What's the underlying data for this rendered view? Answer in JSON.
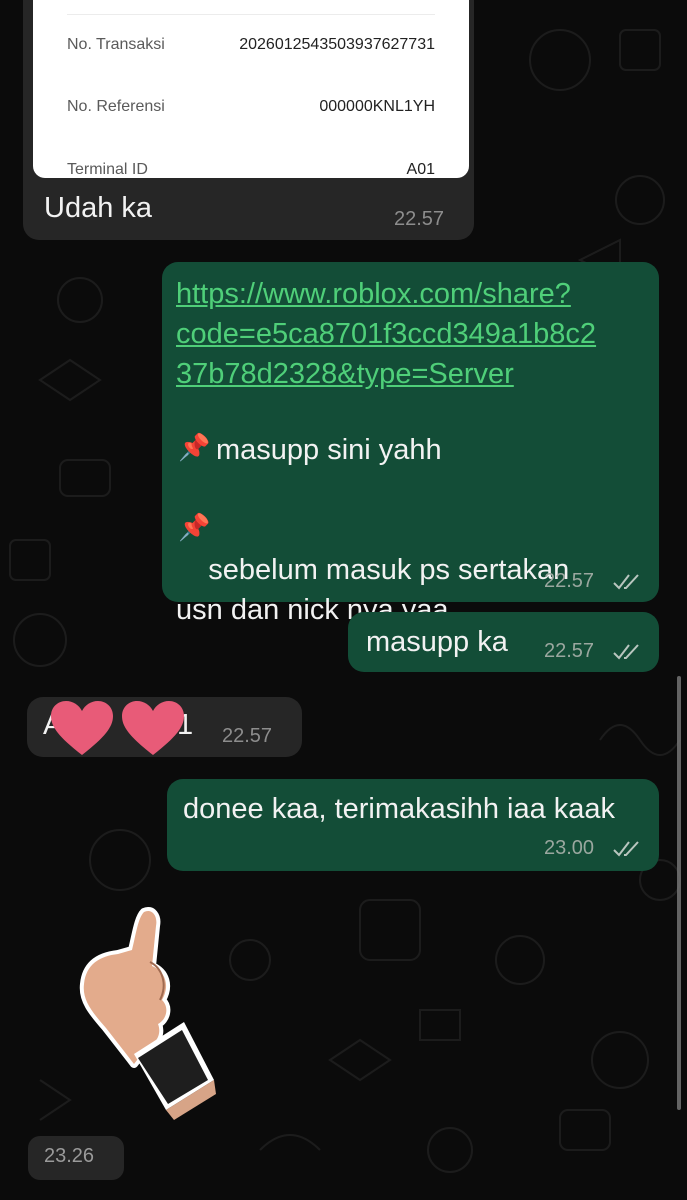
{
  "receipt": {
    "rows": [
      {
        "label": "No. Transaksi",
        "value": "2026012543503937627731"
      },
      {
        "label": "No. Referensi",
        "value": "000000KNL1YH"
      },
      {
        "label": "Terminal ID",
        "value": "A01"
      }
    ]
  },
  "messages": [
    {
      "id": "m1",
      "direction": "incoming",
      "text": "Udah ka",
      "time": "22.57"
    },
    {
      "id": "m2",
      "direction": "outgoing",
      "link": "https://www.roblox.com/share?\ncode=e5ca8701f3ccd349a1b8c2\n37b78d2328&type=Server",
      "line1": "masupp sini yahh",
      "line2": "sebelum masuk ps sertakan\nusn dan nick nya yaa",
      "time": "22.57",
      "status": "read"
    },
    {
      "id": "m3",
      "direction": "outgoing",
      "text": "masupp ka",
      "time": "22.57",
      "status": "read"
    },
    {
      "id": "m4",
      "direction": "incoming",
      "text_start": "A",
      "text_end": "1",
      "time": "22.57"
    },
    {
      "id": "m5",
      "direction": "outgoing",
      "text": "donee kaa, terimakasihh iaa kaak",
      "time": "23.00",
      "status": "read"
    },
    {
      "id": "m6",
      "direction": "incoming",
      "sticker": "thumbs-up-hand-sticker",
      "time": "23.26"
    }
  ],
  "colors": {
    "background": "#0b0b0b",
    "incoming_bubble": "#262626",
    "outgoing_bubble": "#134d37",
    "link": "#4fcf79",
    "heart": "#e85b78"
  },
  "icons": [
    "pushpin-icon",
    "read-ticks-icon",
    "heart-icon"
  ]
}
